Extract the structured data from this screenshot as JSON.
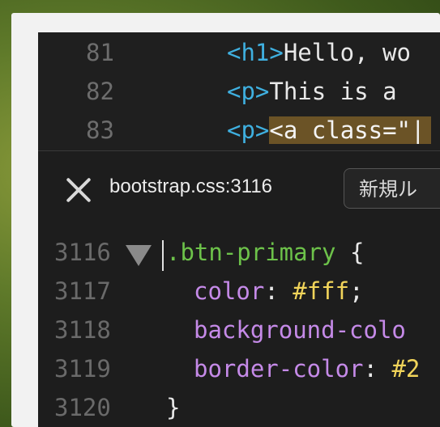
{
  "top_code": [
    {
      "line": "81",
      "tag_open": "<h1>",
      "text": "Hello, wo"
    },
    {
      "line": "82",
      "tag_open": "<p>",
      "text": "This is a"
    },
    {
      "line": "83",
      "tag_open": "<p>",
      "highlighted": "<a class=\"|"
    }
  ],
  "rule_header": {
    "filename": "bootstrap.css",
    "colon": ":",
    "line_number": "3116",
    "new_rule_button": "新規ル"
  },
  "css_lines": [
    {
      "line": "3116",
      "selector": ".btn-primary",
      "brace": " {"
    },
    {
      "line": "3117",
      "property": "color",
      "sep": ": ",
      "value": "#fff",
      "end": ";"
    },
    {
      "line": "3118",
      "property": "background-colo"
    },
    {
      "line": "3119",
      "property": "border-color",
      "sep": ": ",
      "value": "#2"
    },
    {
      "line": "3120",
      "closing": "}"
    }
  ],
  "icons": {
    "close": "close-icon",
    "collapse": "triangle-down-icon"
  }
}
